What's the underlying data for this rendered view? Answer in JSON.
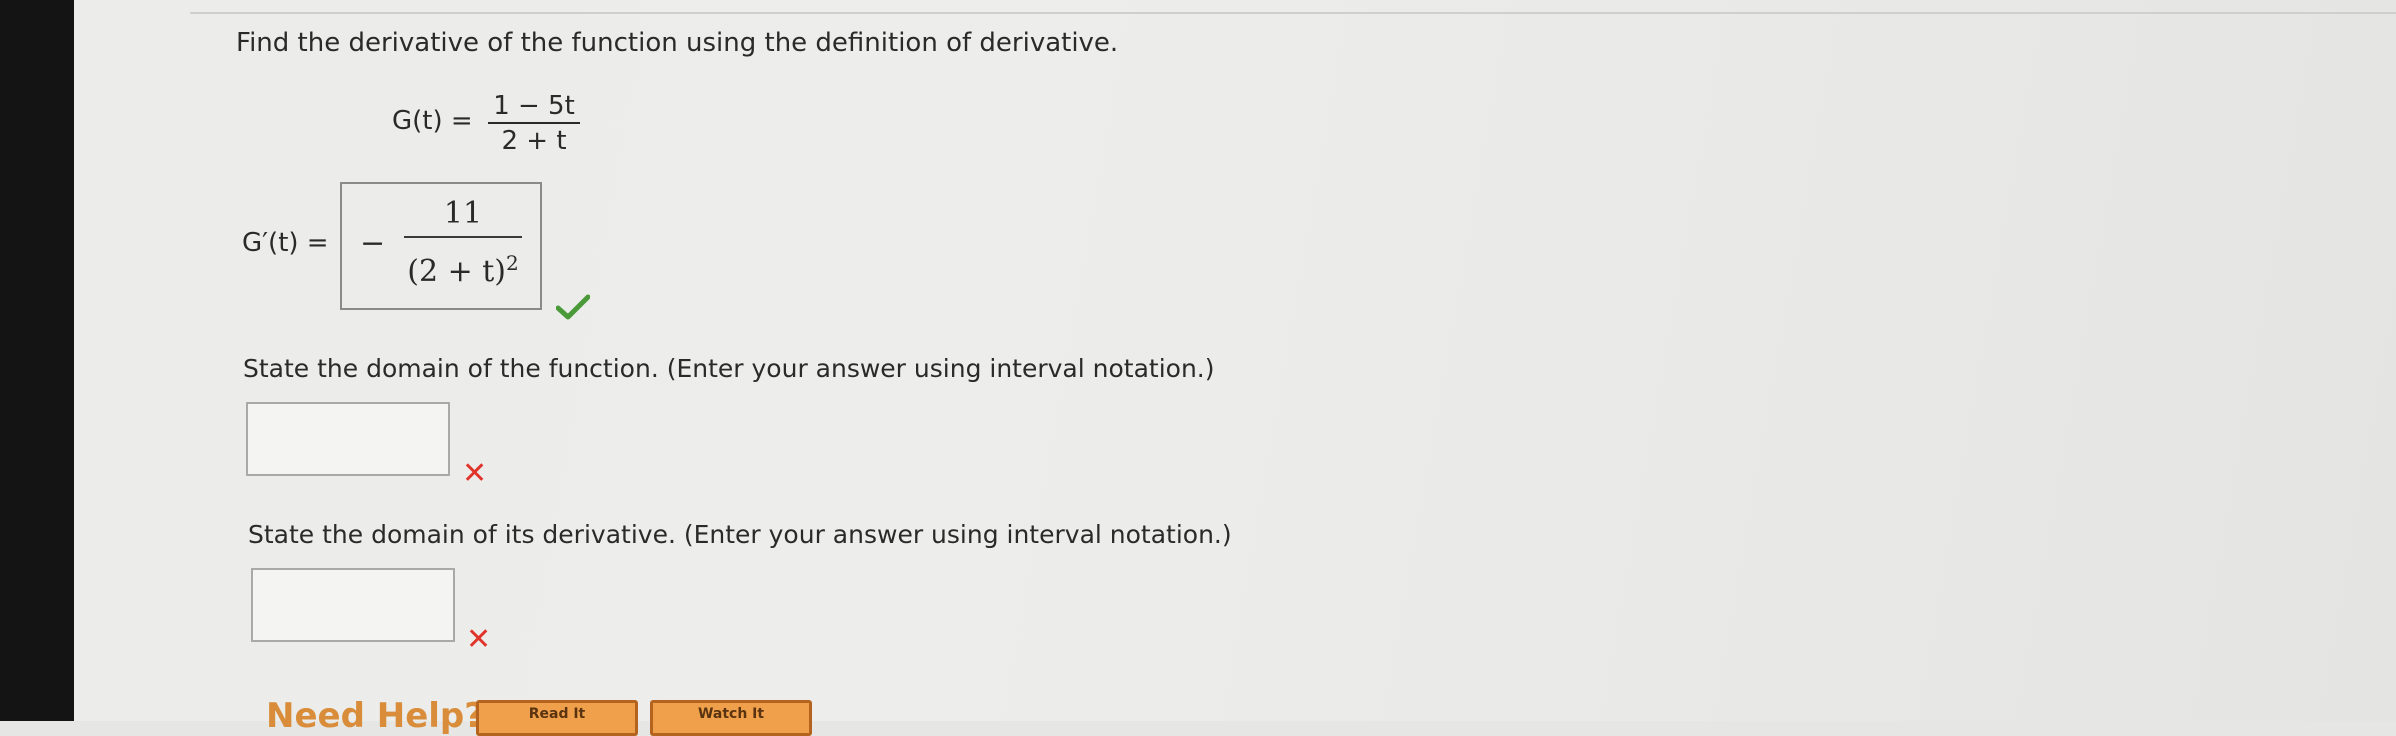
{
  "question": {
    "instruction": "Find the derivative of the function using the definition of derivative.",
    "function_lhs": "G(t) =",
    "function_numerator": "1 − 5t",
    "function_denominator": "2 + t",
    "derivative_lhs": "G′(t) =",
    "derivative_answer": {
      "sign": "−",
      "numerator": "11",
      "denominator": "(2 + t)",
      "exponent": "2",
      "status": "correct"
    }
  },
  "domain_function": {
    "prompt": "State the domain of the function. (Enter your answer using interval notation.)",
    "value": "",
    "status": "incorrect"
  },
  "domain_derivative": {
    "prompt": "State the domain of its derivative. (Enter your answer using interval notation.)",
    "value": "",
    "status": "incorrect"
  },
  "help": {
    "label": "Need Help?",
    "buttons": [
      "Read It",
      "Watch It"
    ]
  },
  "colors": {
    "correct": "#4a9a3a",
    "incorrect": "#e0342b",
    "help_accent": "#f0a04a"
  },
  "icons": {
    "correct": "check-icon",
    "incorrect": "x-mark-icon"
  }
}
